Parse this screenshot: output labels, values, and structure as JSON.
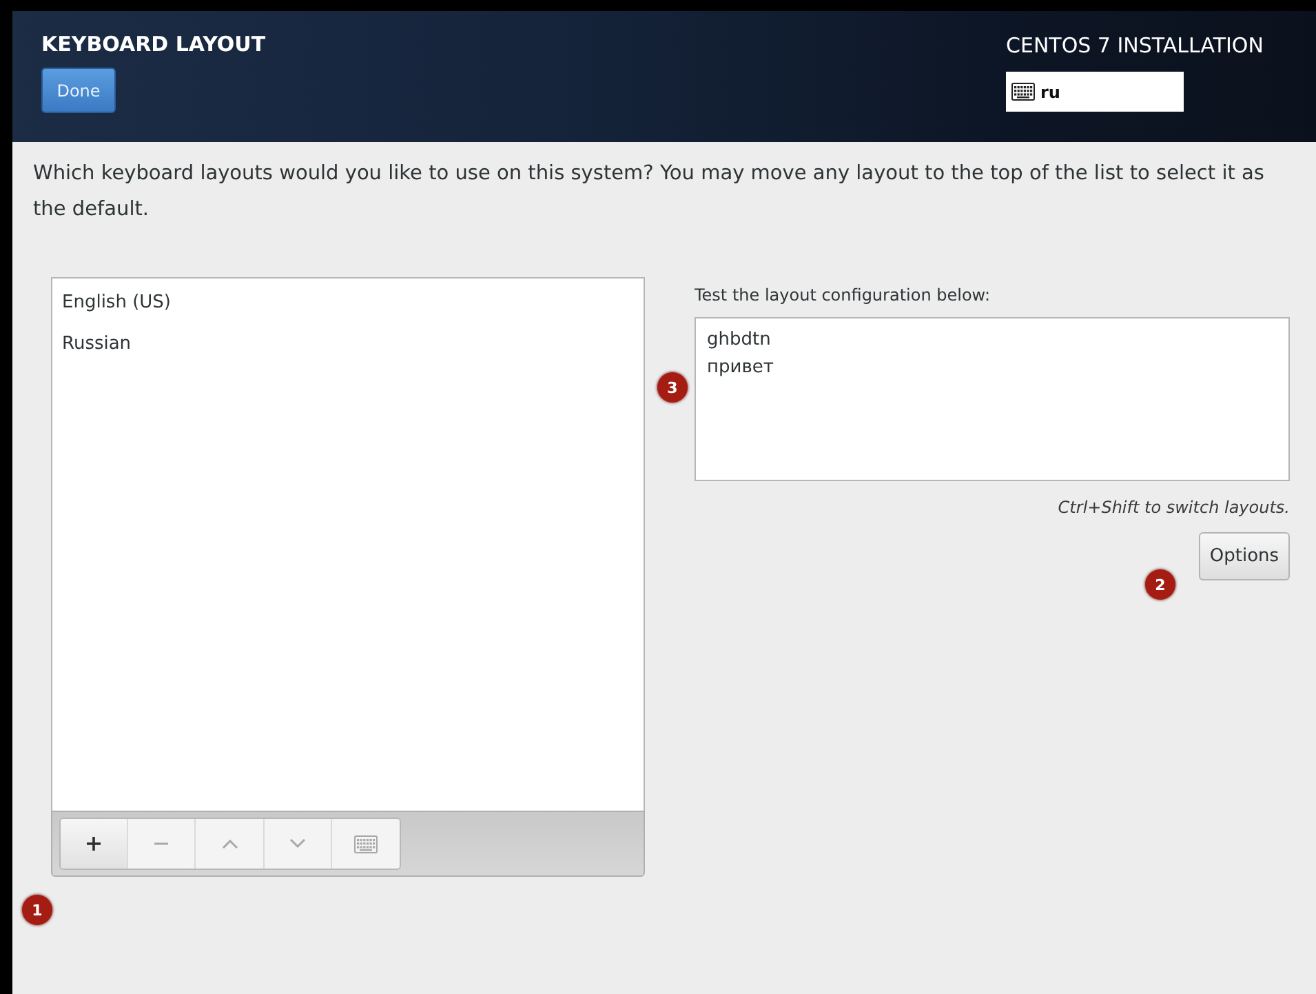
{
  "header": {
    "title": "KEYBOARD LAYOUT",
    "done_button": "Done",
    "product": "CENTOS 7 INSTALLATION",
    "layout_indicator": "ru"
  },
  "intro": "Which keyboard layouts would you like to use on this system?  You may move any layout to the top of the list to select it as the default.",
  "layouts": [
    {
      "name": "English (US)"
    },
    {
      "name": "Russian"
    }
  ],
  "toolbar_callout": "1",
  "toolbar": [
    {
      "kind": "add",
      "disabled": false
    },
    {
      "kind": "remove",
      "disabled": true
    },
    {
      "kind": "up",
      "disabled": true
    },
    {
      "kind": "down",
      "disabled": true
    },
    {
      "kind": "preview",
      "disabled": true
    }
  ],
  "test": {
    "label": "Test the layout configuration below:",
    "value": "ghbdtn\nпривет",
    "hint": "Ctrl+Shift to switch layouts.",
    "options_button": "Options",
    "field_callout": "3",
    "options_callout": "2"
  }
}
